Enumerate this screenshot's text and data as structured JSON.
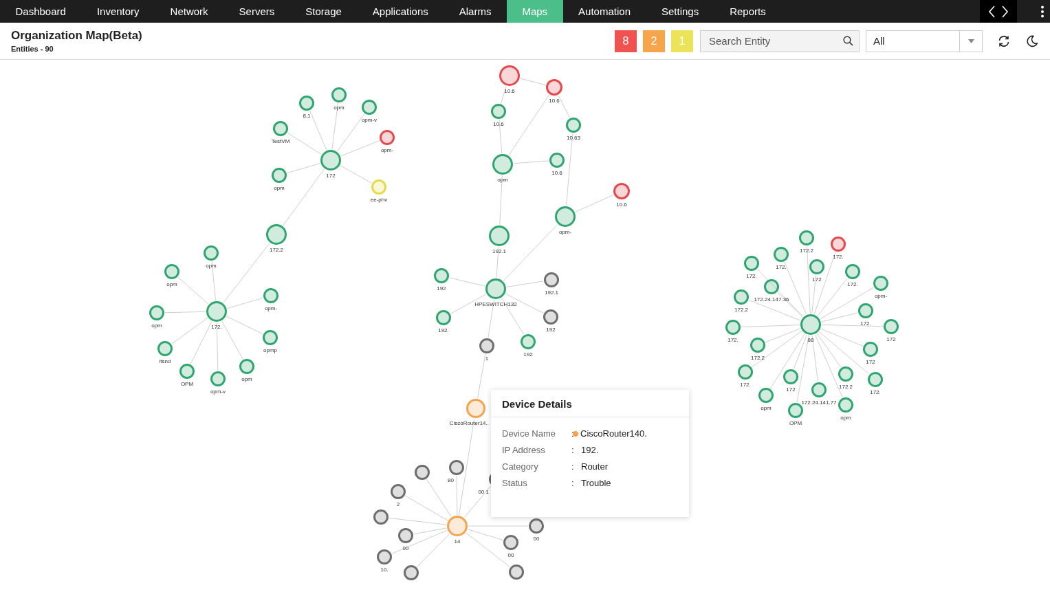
{
  "nav": {
    "items": [
      {
        "label": "Dashboard",
        "selected": false
      },
      {
        "label": "Inventory",
        "selected": false
      },
      {
        "label": "Network",
        "selected": false
      },
      {
        "label": "Servers",
        "selected": false
      },
      {
        "label": "Storage",
        "selected": false
      },
      {
        "label": "Applications",
        "selected": false
      },
      {
        "label": "Alarms",
        "selected": false
      },
      {
        "label": "Maps",
        "selected": true
      },
      {
        "label": "Automation",
        "selected": false
      },
      {
        "label": "Settings",
        "selected": false
      },
      {
        "label": "Reports",
        "selected": false
      }
    ]
  },
  "header": {
    "title": "Organization Map(Beta)",
    "subtitle": "Entities - 90",
    "alarm_counts": [
      {
        "count": "8",
        "color": "#f0524f"
      },
      {
        "count": "2",
        "color": "#f7a54a"
      },
      {
        "count": "1",
        "color": "#ebe35a"
      }
    ],
    "search": {
      "placeholder": "Search Entity"
    },
    "filter": {
      "value": "All"
    }
  },
  "map": {
    "clusters": [
      {
        "nodes": [
          {
            "label": "opm",
            "color": "#2fa56f"
          },
          {
            "label": "8.1",
            "color": "#2fa56f"
          },
          {
            "label": "opm-v",
            "color": "#2fa56f"
          },
          {
            "label": "TestVM",
            "color": "#2fa56f"
          },
          {
            "label": "opm-",
            "color": "#e5484d"
          },
          {
            "label": "172",
            "color": "#2fa56f"
          },
          {
            "label": "opm",
            "color": "#2fa56f"
          },
          {
            "label": "ee-phv",
            "color": "#e3dc48"
          },
          {
            "label": "172.2",
            "color": "#2fa56f"
          },
          {
            "label": "opm",
            "color": "#2fa56f"
          },
          {
            "label": "opm",
            "color": "#2fa56f"
          },
          {
            "label": "opm-",
            "color": "#2fa56f"
          },
          {
            "label": "opm",
            "color": "#2fa56f"
          },
          {
            "label": "172.",
            "color": "#2fa56f"
          },
          {
            "label": "opmp",
            "color": "#2fa56f"
          },
          {
            "label": "itsnd",
            "color": "#2fa56f"
          },
          {
            "label": "opm",
            "color": "#2fa56f"
          },
          {
            "label": "OPM",
            "color": "#2fa56f"
          },
          {
            "label": "opm-v",
            "color": "#2fa56f"
          }
        ]
      },
      {
        "nodes": [
          {
            "label": "10.6",
            "color": "#e5484d"
          },
          {
            "label": "10.6",
            "color": "#e5484d"
          },
          {
            "label": "10.6",
            "color": "#2fa56f"
          },
          {
            "label": "10.63",
            "color": "#2fa56f"
          },
          {
            "label": "10.6",
            "color": "#2fa56f"
          },
          {
            "label": "opm",
            "color": "#2fa56f"
          },
          {
            "label": "10.6",
            "color": "#e5484d"
          },
          {
            "label": "opm-",
            "color": "#2fa56f"
          },
          {
            "label": "192.1",
            "color": "#2fa56f"
          },
          {
            "label": "192",
            "color": "#2fa56f"
          },
          {
            "label": "192.1",
            "color": "#6e6e6e"
          },
          {
            "label": "HPESWITCH132",
            "color": "#2fa56f"
          },
          {
            "label": "192.",
            "color": "#2fa56f"
          },
          {
            "label": "192",
            "color": "#6e6e6e"
          },
          {
            "label": "1",
            "color": "#6e6e6e"
          },
          {
            "label": "192",
            "color": "#2fa56f"
          },
          {
            "label": "CiscoRouter14..",
            "color": "#f3a44e"
          },
          {
            "color": "#6e6e6e"
          },
          {
            "label": "80",
            "color": "#6e6e6e"
          },
          {
            "label": "00 1",
            "color": "#6e6e6e"
          },
          {
            "label": "2",
            "color": "#6e6e6e"
          },
          {
            "color": "#6e6e6e"
          },
          {
            "label": "14",
            "color": "#f3a44e"
          },
          {
            "label": "00",
            "color": "#6e6e6e"
          },
          {
            "label": "00",
            "color": "#6e6e6e"
          },
          {
            "label": "00",
            "color": "#6e6e6e"
          },
          {
            "label": "10.",
            "color": "#6e6e6e"
          },
          {
            "color": "#6e6e6e"
          },
          {
            "color": "#6e6e6e"
          }
        ]
      },
      {
        "nodes": [
          {
            "label": "172.2",
            "color": "#2fa56f"
          },
          {
            "label": "172.",
            "color": "#e5484d"
          },
          {
            "label": "172.",
            "color": "#2fa56f"
          },
          {
            "label": "172.",
            "color": "#2fa56f"
          },
          {
            "label": "172",
            "color": "#2fa56f"
          },
          {
            "label": "172.",
            "color": "#2fa56f"
          },
          {
            "label": "172.24.147.36",
            "color": "#2fa56f"
          },
          {
            "label": "opm-",
            "color": "#2fa56f"
          },
          {
            "label": "172.2",
            "color": "#2fa56f"
          },
          {
            "label": "172.",
            "color": "#2fa56f"
          },
          {
            "label": "172.",
            "color": "#2fa56f"
          },
          {
            "label": "88",
            "color": "#2fa56f"
          },
          {
            "label": "172",
            "color": "#2fa56f"
          },
          {
            "label": "172.2",
            "color": "#2fa56f"
          },
          {
            "label": "172",
            "color": "#2fa56f"
          },
          {
            "label": "172.",
            "color": "#2fa56f"
          },
          {
            "label": "172",
            "color": "#2fa56f"
          },
          {
            "label": "172.2",
            "color": "#2fa56f"
          },
          {
            "label": "172.",
            "color": "#2fa56f"
          },
          {
            "label": "172.24.141.77",
            "color": "#2fa56f"
          },
          {
            "label": "opm",
            "color": "#2fa56f"
          },
          {
            "label": "opm",
            "color": "#2fa56f"
          },
          {
            "label": "OPM",
            "color": "#2fa56f"
          }
        ]
      }
    ]
  },
  "device_details": {
    "title": "Device Details",
    "rows": [
      {
        "label": "Device Name",
        "separator": ":",
        "value": "CiscoRouter140.",
        "color": "#f3a44e"
      },
      {
        "label": "IP Address",
        "separator": ":",
        "value": "192."
      },
      {
        "label": "Category",
        "separator": ":",
        "value": "Router"
      },
      {
        "label": "Status",
        "separator": ":",
        "value": "Trouble"
      }
    ]
  }
}
